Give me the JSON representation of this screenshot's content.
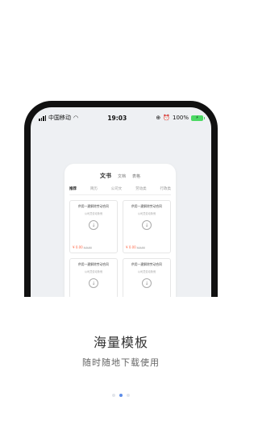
{
  "status_bar": {
    "carrier": "中国移动",
    "time": "19:03",
    "battery_percent": "100%",
    "icons": [
      "signal-icon",
      "wifi-icon",
      "location-icon",
      "alarm-icon",
      "battery-icon"
    ]
  },
  "preview": {
    "top_tabs": [
      "文书",
      "文档",
      "表格"
    ],
    "sub_tabs": [
      "推荐",
      "简历",
      "公司文",
      "劳动类",
      "行政类"
    ],
    "template_cards": [
      {
        "title": "供用一建解除劳动合同",
        "subtitle": "公司员劳动条例",
        "price": "¥ 0.00",
        "original_price": "¥ 9.90"
      },
      {
        "title": "供用一建解除劳动合同",
        "subtitle": "公司员劳动条例",
        "price": "¥ 0.00",
        "original_price": "¥ 9.90"
      },
      {
        "title": "供用一建解除劳动合同",
        "subtitle": "公司员劳动条例",
        "price": "",
        "original_price": ""
      },
      {
        "title": "供用一建解除劳动合同",
        "subtitle": "公司员劳动条例",
        "price": "",
        "original_price": ""
      }
    ]
  },
  "onboarding": {
    "title": "海量模板",
    "subtitle": "随时随地下载使用",
    "page_indicator": {
      "count": 3,
      "active_index": 1
    }
  },
  "colors": {
    "accent": "#5d8de8",
    "price": "#ff6a4a",
    "phone_frame": "#111111",
    "screen_bg": "#eef0f3"
  }
}
